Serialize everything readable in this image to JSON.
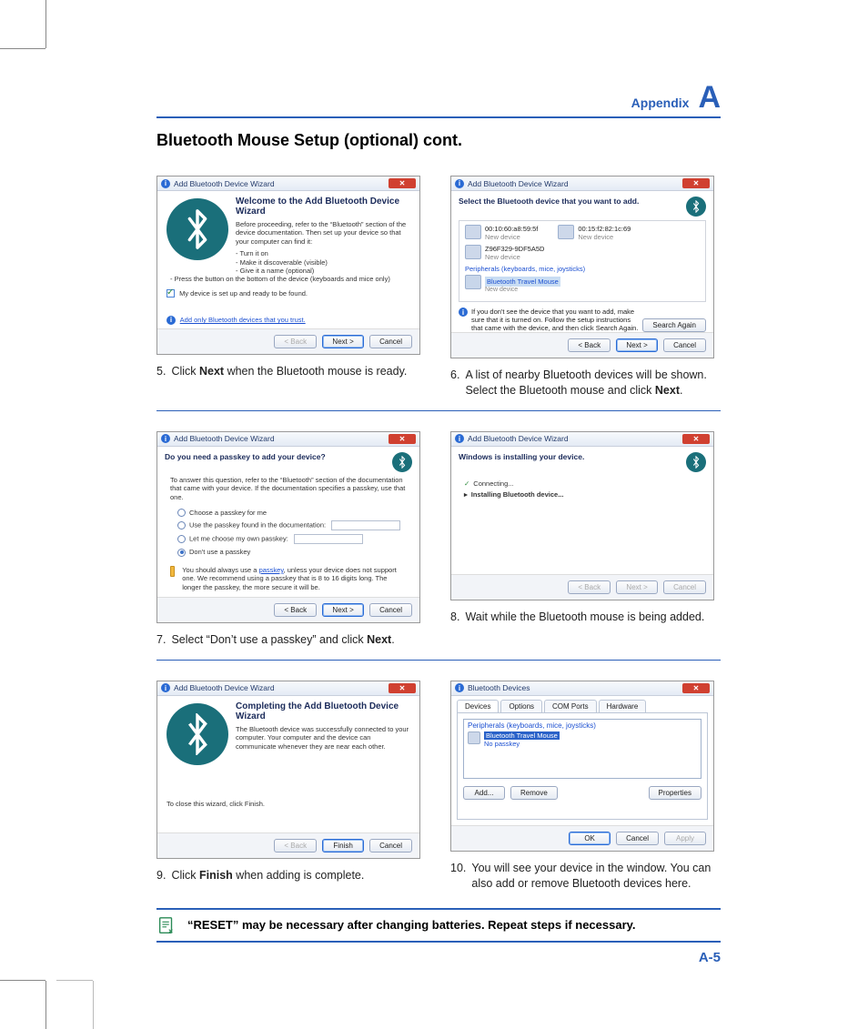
{
  "header": {
    "label": "Appendix",
    "letter": "A"
  },
  "title": "Bluetooth Mouse Setup (optional) cont.",
  "page_number": "A-5",
  "note": "“RESET” may be necessary after changing batteries. Repeat steps if necessary.",
  "wizard_title": "Add Bluetooth Device Wizard",
  "btn_back": "< Back",
  "btn_next": "Next >",
  "btn_cancel": "Cancel",
  "btn_finish": "Finish",
  "btn_search": "Search Again",
  "btn_ok": "OK",
  "btn_apply": "Apply",
  "btn_add": "Add...",
  "btn_remove": "Remove",
  "btn_props": "Properties",
  "step5": {
    "head": "Welcome to the Add Bluetooth Device Wizard",
    "intro": "Before proceeding, refer to the “Bluetooth” section of the device documentation. Then set up your device so that your computer can find it:",
    "b1": "Turn it on",
    "b2": "Make it discoverable (visible)",
    "b3": "Give it a name (optional)",
    "b4": "Press the button on the bottom of the device (keyboards and mice only)",
    "chk": "My device is set up and ready to be found.",
    "trust": "Add only Bluetooth devices that you trust.",
    "cap_num": "5.",
    "cap_a": "Click ",
    "cap_bold": "Next",
    "cap_b": " when the Bluetooth mouse is ready."
  },
  "step6": {
    "head": "Select the Bluetooth device that you want to add.",
    "dev1_id": "00:10:60:a8:59:5f",
    "dev1_sub": "New device",
    "dev2_id": "00:15:f2:82:1c:69",
    "dev2_sub": "New device",
    "dev3_id": "Z96F329-9DF5A5D",
    "dev3_sub": "New device",
    "periph": "Peripherals (keyboards, mice, joysticks)",
    "sel_name": "Bluetooth Travel Mouse",
    "sel_sub": "New device",
    "hint": "If you don't see the device that you want to add, make sure that it is turned on. Follow the setup instructions that came with the device, and then click Search Again.",
    "cap_num": "6.",
    "cap_a": "A list of nearby Bluetooth devices will be shown. Select the Bluetooth mouse and click ",
    "cap_bold": "Next",
    "cap_b": "."
  },
  "step7": {
    "head": "Do you need a passkey to add your device?",
    "intro": "To answer this question, refer to the “Bluetooth” section of the documentation that came with your device. If the documentation specifies a passkey, use that one.",
    "r1": "Choose a passkey for me",
    "r2": "Use the passkey found in the documentation:",
    "r3": "Let me choose my own passkey:",
    "r4": "Don't use a passkey",
    "warn": "You should always use a passkey, unless your device does not support one. We recommend using a passkey that is 8 to 16 digits long. The longer the passkey, the more secure it will be.",
    "warn_link": "passkey",
    "cap_num": "7.",
    "cap_a": "Select “Don’t use a passkey” and click ",
    "cap_bold": "Next",
    "cap_b": "."
  },
  "step8": {
    "head": "Windows is installing your device.",
    "l1": "Connecting...",
    "l2": "Installing Bluetooth device...",
    "cap_num": "8.",
    "cap": "Wait while the Bluetooth mouse is being added."
  },
  "step9": {
    "head": "Completing the Add Bluetooth Device Wizard",
    "body": "The Bluetooth device was successfully connected to your computer. Your computer and the device can communicate whenever they are near each other.",
    "close": "To close this wizard, click Finish.",
    "cap_num": "9.",
    "cap_a": "Click ",
    "cap_bold": "Finish",
    "cap_b": " when adding is complete."
  },
  "step10": {
    "title": "Bluetooth Devices",
    "tab1": "Devices",
    "tab2": "Options",
    "tab3": "COM Ports",
    "tab4": "Hardware",
    "list_head": "Peripherals (keyboards, mice, joysticks)",
    "item_name": "Bluetooth Travel Mouse",
    "item_sub": "No passkey",
    "cap_num": "10.",
    "cap": "You will see your device in the window. You can also add or remove Bluetooth devices here."
  }
}
